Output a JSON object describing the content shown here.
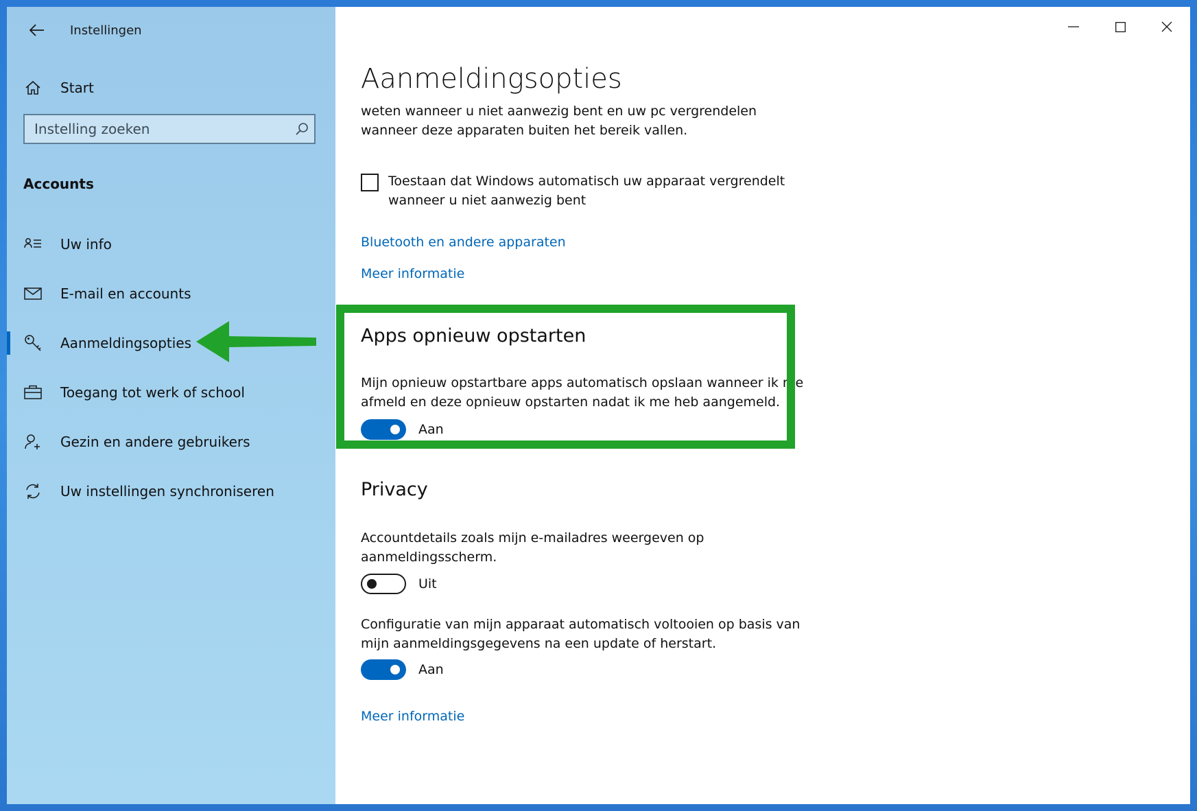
{
  "window": {
    "app_title": "Instellingen",
    "controls": [
      "minimize-icon",
      "maximize-icon",
      "close-icon"
    ]
  },
  "sidebar": {
    "start_label": "Start",
    "search": {
      "placeholder": "Instelling zoeken",
      "value": ""
    },
    "section_title": "Accounts",
    "items": [
      {
        "label": "Uw info",
        "icon": "user-info-icon"
      },
      {
        "label": "E-mail en accounts",
        "icon": "mail-icon"
      },
      {
        "label": "Aanmeldingsopties",
        "icon": "key-icon",
        "selected": true
      },
      {
        "label": "Toegang tot werk of school",
        "icon": "briefcase-icon"
      },
      {
        "label": "Gezin en andere gebruikers",
        "icon": "add-person-icon"
      },
      {
        "label": "Uw instellingen synchroniseren",
        "icon": "sync-icon"
      }
    ]
  },
  "main": {
    "title": "Aanmeldingsopties",
    "intro_text": "weten wanneer u niet aanwezig bent en uw pc vergrendelen wanneer deze apparaten buiten het bereik vallen.",
    "dynamic_lock_checkbox": {
      "label": "Toestaan dat Windows automatisch uw apparaat vergrendelt wanneer u niet aanwezig bent",
      "checked": false
    },
    "link_bluetooth": "Bluetooth en andere apparaten",
    "link_more_info_1": "Meer informatie",
    "restart_apps": {
      "heading": "Apps opnieuw opstarten",
      "description": "Mijn opnieuw opstartbare apps automatisch opslaan wanneer ik me afmeld en deze opnieuw opstarten nadat ik me heb aangemeld.",
      "toggle": {
        "state": "on",
        "label": "Aan"
      }
    },
    "privacy": {
      "heading": "Privacy",
      "account_details": {
        "description": "Accountdetails zoals mijn e-mailadres weergeven op aanmeldingsscherm.",
        "toggle": {
          "state": "off",
          "label": "Uit"
        }
      },
      "auto_config": {
        "description": "Configuratie van mijn apparaat automatisch voltooien op basis van mijn aanmeldingsgegevens na een update of herstart.",
        "toggle": {
          "state": "on",
          "label": "Aan"
        }
      },
      "link_more_info": "Meer informatie"
    }
  },
  "colors": {
    "accent": "#0067c0",
    "link": "#0067b8",
    "annotation_green": "#21a22a",
    "sidebar_bg": "#a3d2ef"
  }
}
